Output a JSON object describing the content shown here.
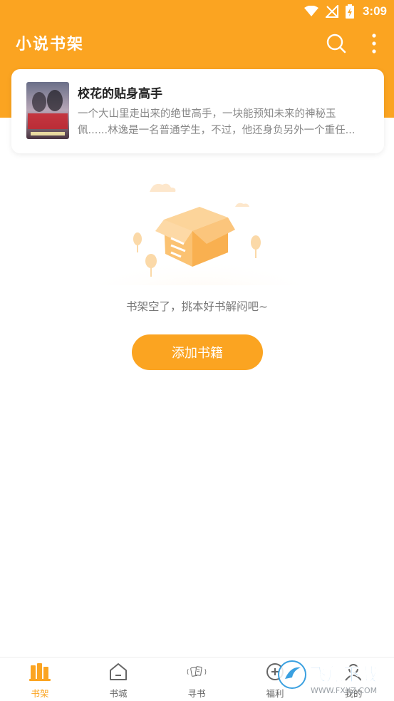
{
  "status_bar": {
    "time": "3:09"
  },
  "header": {
    "title": "小说书架",
    "search_icon": "search-icon",
    "more_icon": "more-vertical-icon"
  },
  "book": {
    "title": "校花的贴身高手",
    "desc_line1": "一个大山里走出来的绝世高手，一块能预知未来的神秘玉",
    "desc_line2": "佩......林逸是一名普通学生，不过，他还身负另外一个重任...",
    "cover_text": "校花的贴身高手"
  },
  "empty": {
    "message": "书架空了，挑本好书解闷吧~",
    "add_button": "添加书籍"
  },
  "bottom_nav": {
    "items": [
      {
        "label": "书架",
        "icon": "bookshelf-icon",
        "active": true
      },
      {
        "label": "书城",
        "icon": "home-icon",
        "active": false
      },
      {
        "label": "寻书",
        "icon": "find-book-icon",
        "active": false
      },
      {
        "label": "福利",
        "icon": "gift-icon",
        "active": false
      },
      {
        "label": "我的",
        "icon": "profile-icon",
        "active": false
      }
    ]
  },
  "watermark": {
    "brand": "飞翔下载",
    "url": "WWW.FXXZ.COM"
  },
  "colors": {
    "accent": "#fba421",
    "white": "#ffffff",
    "text_muted": "#888888"
  }
}
